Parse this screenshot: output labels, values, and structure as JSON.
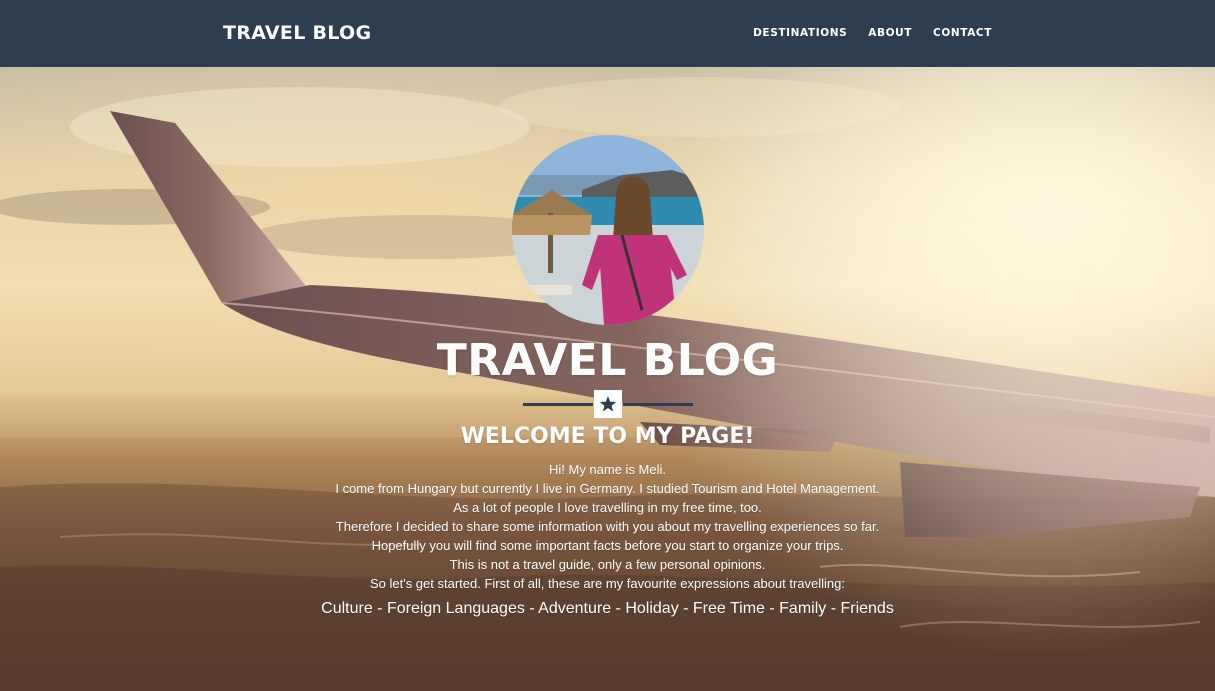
{
  "navbar": {
    "brand": "TRAVEL BLOG",
    "links": [
      {
        "label": "DESTINATIONS"
      },
      {
        "label": "ABOUT"
      },
      {
        "label": "CONTACT"
      }
    ],
    "background_color": "#2c3e50"
  },
  "hero": {
    "avatar_alt": "profile photo",
    "title": "TRAVEL BLOG",
    "divider_icon": "star-icon",
    "welcome": "WELCOME TO MY PAGE!",
    "intro_lines": [
      "Hi! My name is Meli.",
      "I come from Hungary but currently I live in Germany. I studied Tourism and Hotel Management.",
      "As a lot of people I love travelling in my free time, too.",
      "Therefore I decided to share some information with you about my travelling experiences so far.",
      "Hopefully you will find some important facts before you start to organize your trips.",
      "This is not a travel guide, only a few personal opinions.",
      "So let's get started. First of all, these are my favourite expressions about travelling:"
    ],
    "expressions": "Culture - Foreign Languages - Adventure - Holiday - Free Time - Family - Friends"
  },
  "colors": {
    "accent": "#2c3e50",
    "text": "#ffffff"
  }
}
